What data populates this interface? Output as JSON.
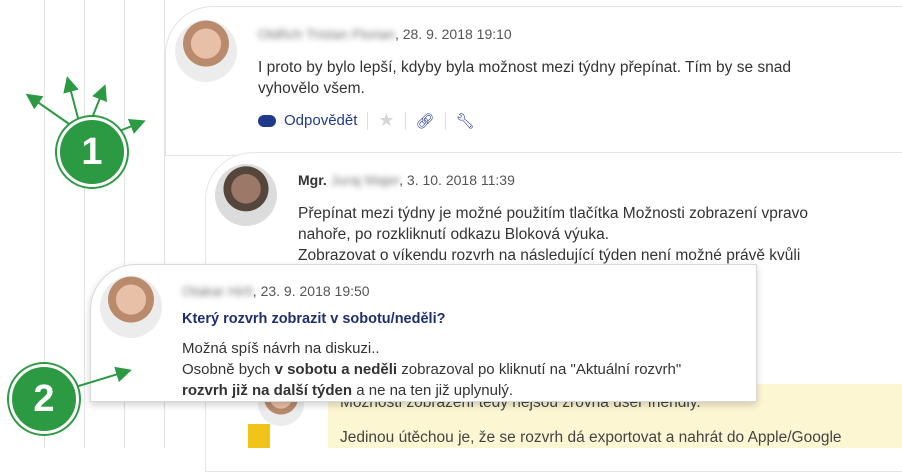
{
  "comment1": {
    "author": "Oldřich Tristan Florian",
    "date": "28. 9. 2018 19:10",
    "text_line1": "I proto by bylo lepší, kdyby byla možnost mezi týdny přepínat. Tím by se snad",
    "text_line2": "vyhovělo všem.",
    "reply_label": "Odpovědět"
  },
  "comment2": {
    "title_prefix": "Mgr.",
    "author": "Juraj Majer",
    "date": "3. 10. 2018 11:39",
    "line1": "Přepínat mezi týdny je možné použitím tlačítka Možnosti zobrazení vpravo",
    "line2": "nahoře, po rozkliknutí odkazu Bloková výuka.",
    "line3": "Zobrazovat o víkendu rozvrh na následující týden není možné právě kvůli"
  },
  "popup": {
    "author": "Otakar Hirš",
    "date": "23. 9. 2018 19:50",
    "title": "Který rozvrh zobrazit v sobotu/neděli?",
    "line1": "Možná spíš návrh na diskuzi..",
    "line2_a": "Osobně bych ",
    "line2_b": "v sobotu a neděli",
    "line2_c": " zobrazoval po kliknutí na \"Aktuální rozvrh\"",
    "line3_a": "rozvrh již na další týden",
    "line3_b": " a ne na ten již uplynulý."
  },
  "bottom_note": {
    "line1": "Možnosti zobrazení tedy nejsou zrovna user friendly.",
    "line2": "Jedinou útěchou je, že se rozvrh dá exportovat a nahrát do Apple/Google"
  },
  "badges": {
    "one": "1",
    "two": "2"
  },
  "colors": {
    "badge_green": "#2b9a43",
    "link_blue": "#1f3a8a",
    "note_yellow": "#fdf6d3"
  }
}
